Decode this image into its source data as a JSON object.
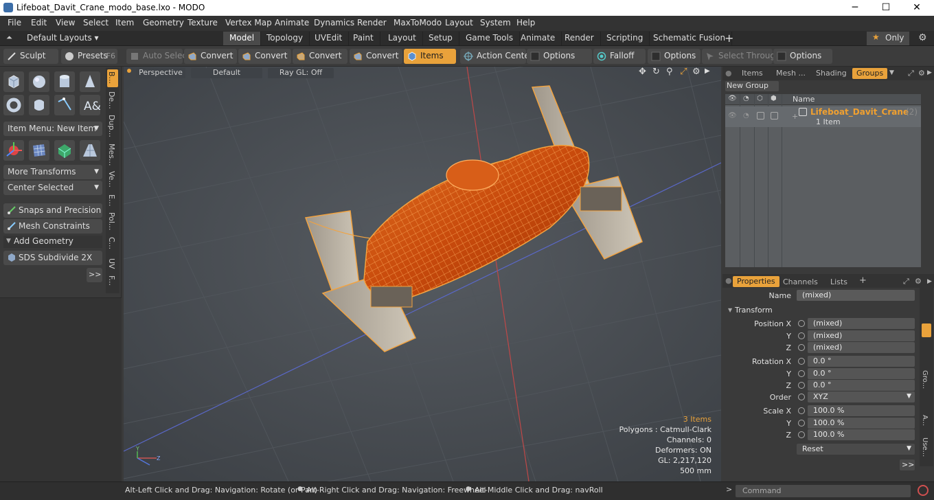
{
  "window": {
    "title": "Lifeboat_Davit_Crane_modo_base.lxo - MODO",
    "minimize": "─",
    "maximize": "☐",
    "close": "✕"
  },
  "menu": [
    "File",
    "Edit",
    "View",
    "Select",
    "Item",
    "Geometry",
    "Texture",
    "Vertex Map",
    "Animate",
    "Dynamics",
    "Render",
    "MaxToModo",
    "Layout",
    "System",
    "Help"
  ],
  "layoutbar": {
    "layouts": "Default Layouts ▾",
    "tabs": [
      "Model",
      "Topology",
      "UVEdit",
      "Paint",
      "Layout",
      "Setup",
      "Game Tools",
      "Animate",
      "Render",
      "Scripting",
      "Schematic Fusion"
    ],
    "active": "Model",
    "plus": "+",
    "only": "Only"
  },
  "toolbar": {
    "sculpt": "Sculpt",
    "presets": "Presets",
    "presets_key": "F6",
    "auto_select": "Auto Select",
    "convert1": "Convert",
    "convert2": "Convert",
    "convert3": "Convert",
    "convert4": "Convert",
    "items": "Items",
    "action_center": "Action Center",
    "options1": "Options",
    "falloff": "Falloff",
    "options2": "Options",
    "select_through": "Select Through",
    "options3": "Options"
  },
  "left": {
    "item_menu": "Item Menu: New Item",
    "more_transforms": "More Transforms",
    "center_selected": "Center Selected",
    "snaps": "Snaps and Precision",
    "mesh_constraints": "Mesh Constraints",
    "add_geometry": "Add Geometry",
    "sds": "SDS Subdivide 2X",
    "more": ">>",
    "vtabs": [
      "B...",
      "De...",
      "Dup...",
      "Mes...",
      "Ve...",
      "E...",
      "Pol...",
      "C...",
      "UV",
      "F..."
    ]
  },
  "viewport": {
    "perspective": "Perspective",
    "default": "Default",
    "raygl": "Ray GL: Off"
  },
  "stats": {
    "items": "3 Items",
    "polygons": "Polygons : Catmull-Clark",
    "channels": "Channels: 0",
    "deformers": "Deformers: ON",
    "gl": "GL: 2,217,120",
    "scale": "500 mm"
  },
  "status": {
    "hint1": "Alt-Left Click and Drag: Navigation: Rotate (or Pan)",
    "hint2": "Alt-Right Click and Drag: Navigation: Freewheel",
    "hint3": "Alt-Middle Click and Drag: navRoll",
    "command": "Command"
  },
  "groups": {
    "tabs": [
      "Items",
      "Mesh ...",
      "Shading",
      "Groups"
    ],
    "active": "Groups",
    "new_group": "New Group",
    "name_header": "Name",
    "group_name": "Lifeboat_Davit_Crane",
    "group_count": "(2)",
    "group_sub": "1 Item"
  },
  "properties": {
    "tabs": [
      "Properties",
      "Channels",
      "Lists"
    ],
    "plus": "+",
    "name_label": "Name",
    "name_value": "(mixed)",
    "transform": "Transform",
    "position_label": "Position X",
    "pos": [
      "(mixed)",
      "(mixed)",
      "(mixed)"
    ],
    "rotation_label": "Rotation X",
    "rot": [
      "0.0 °",
      "0.0 °",
      "0.0 °"
    ],
    "order_label": "Order",
    "order": "XYZ",
    "scale_label": "Scale X",
    "scl": [
      "100.0 %",
      "100.0 %",
      "100.0 %"
    ],
    "y": "Y",
    "z": "Z",
    "reset": "Reset",
    "more": ">>",
    "sidetabs": [
      "Gro...",
      "A...",
      "Use..."
    ]
  },
  "colors": {
    "accent": "#e9a23b",
    "mesh": "#e05a10",
    "wire": "#f2a340"
  }
}
